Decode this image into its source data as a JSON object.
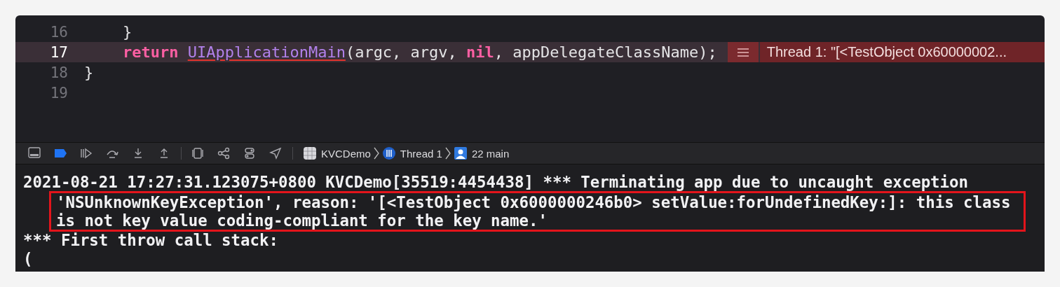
{
  "editor": {
    "lines": [
      {
        "number": "16",
        "current": false,
        "indented": true,
        "tokens": [
          {
            "text": "}",
            "kind": "plain",
            "underlined": false
          }
        ]
      },
      {
        "number": "17",
        "current": true,
        "indented": true,
        "tokens": [
          {
            "text": "return ",
            "kind": "keyword",
            "underlined": false
          },
          {
            "text": "UIApplicationMain",
            "kind": "function",
            "underlined": true
          },
          {
            "text": "(argc, argv, ",
            "kind": "plain",
            "underlined": false
          },
          {
            "text": "nil",
            "kind": "keyword",
            "underlined": false
          },
          {
            "text": ", appDelegateClassName);",
            "kind": "plain",
            "underlined": false
          }
        ]
      },
      {
        "number": "18",
        "current": false,
        "indented": false,
        "tokens": [
          {
            "text": "}",
            "kind": "plain",
            "underlined": false
          }
        ]
      },
      {
        "number": "19",
        "current": false
      }
    ],
    "error_annotation": {
      "message": "Thread 1: \"[<TestObject 0x60000002..."
    }
  },
  "debug_bar": {
    "breakpoints_active": true,
    "breadcrumbs": [
      {
        "kind": "app",
        "label": "KVCDemo"
      },
      {
        "kind": "thread",
        "label": "Thread 1"
      },
      {
        "kind": "frame",
        "label": "22 main"
      }
    ]
  },
  "console": {
    "lines": [
      {
        "text": "2021-08-21 17:27:31.123075+0800 KVCDemo[35519:4454438] *** Terminating app due to uncaught exception",
        "boxed": false
      },
      {
        "text": "'NSUnknownKeyException', reason: '[<TestObject 0x6000000246b0> setValue:forUndefinedKey:]: this class",
        "boxed": true
      },
      {
        "text": "is not key value coding-compliant for the key name.'",
        "boxed": true
      },
      {
        "text": "*** First throw call stack:",
        "boxed": false
      },
      {
        "text": "(",
        "boxed": false
      }
    ]
  }
}
